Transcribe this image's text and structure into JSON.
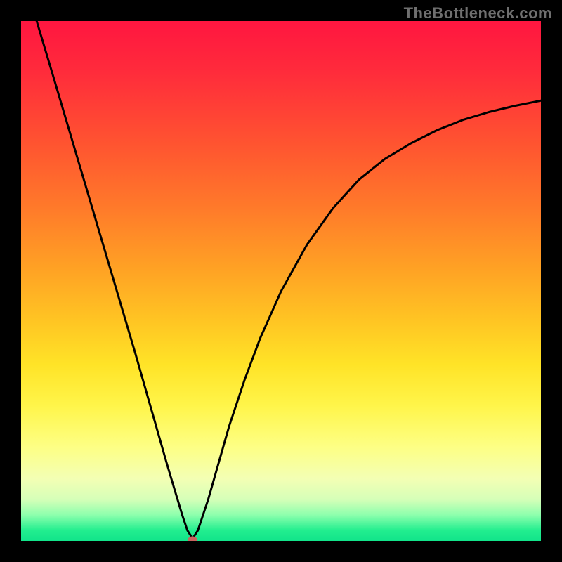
{
  "watermark": "TheBottleneck.com",
  "chart_data": {
    "type": "line",
    "title": "",
    "xlabel": "",
    "ylabel": "",
    "xlim": [
      0,
      100
    ],
    "ylim": [
      0,
      100
    ],
    "series": [
      {
        "name": "bottleneck-curve",
        "x": [
          3,
          6,
          10,
          14,
          18,
          22,
          26,
          28,
          30,
          31,
          32,
          33,
          34,
          36,
          38,
          40,
          43,
          46,
          50,
          55,
          60,
          65,
          70,
          75,
          80,
          85,
          90,
          95,
          100
        ],
        "y": [
          100,
          90,
          76.5,
          63,
          49.5,
          36,
          22,
          15,
          8.3,
          5,
          2,
          0.5,
          2,
          8,
          15,
          22,
          31,
          39,
          48,
          57,
          64,
          69.5,
          73.5,
          76.5,
          79,
          81,
          82.5,
          83.7,
          84.7
        ]
      }
    ],
    "marker": {
      "x": 33,
      "y": 0.2
    },
    "colors": {
      "curve": "#000000",
      "marker": "#c9625e",
      "gradient_top": "#ff1640",
      "gradient_mid": "#ffe327",
      "gradient_bottom": "#11e48a",
      "frame": "#000000"
    }
  }
}
